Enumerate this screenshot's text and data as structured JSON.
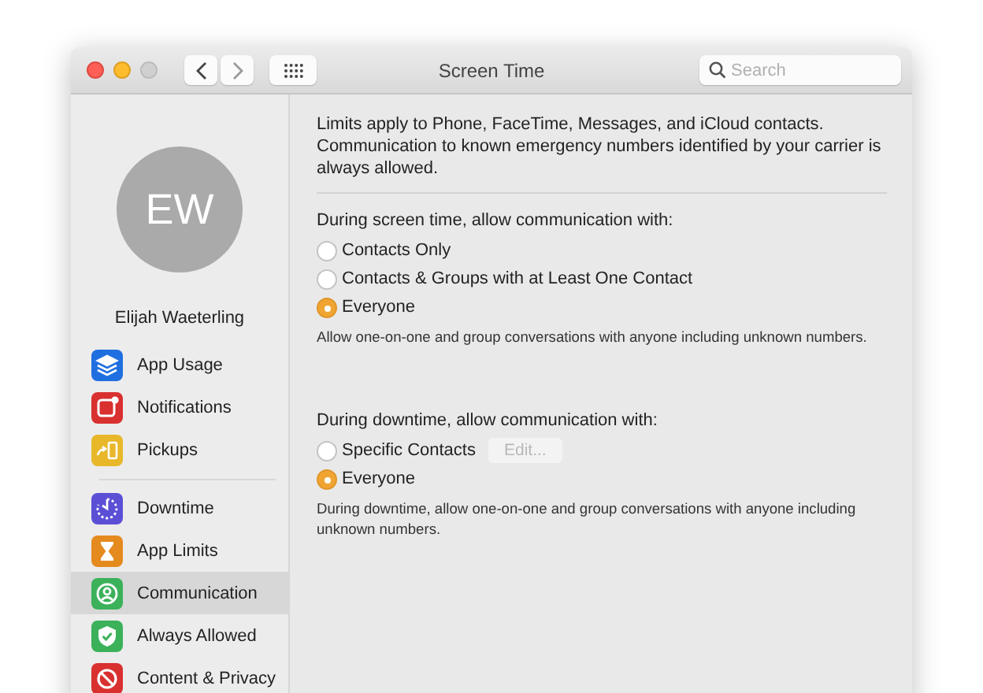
{
  "window": {
    "title": "Screen Time"
  },
  "search": {
    "placeholder": "Search"
  },
  "sidebar": {
    "avatar_initials": "EW",
    "user_name": "Elijah Waeterling",
    "groups": [
      [
        {
          "label": "App Usage",
          "color": "#1f6fe0",
          "selected": false
        },
        {
          "label": "Notifications",
          "color": "#d93030",
          "selected": false
        },
        {
          "label": "Pickups",
          "color": "#e8b82a",
          "selected": false
        }
      ],
      [
        {
          "label": "Downtime",
          "color": "#5b4fd6",
          "selected": false
        },
        {
          "label": "App Limits",
          "color": "#e58a1f",
          "selected": false
        },
        {
          "label": "Communication",
          "color": "#3bb15a",
          "selected": true
        },
        {
          "label": "Always Allowed",
          "color": "#3bb15a",
          "selected": false
        },
        {
          "label": "Content & Privacy",
          "color": "#d93030",
          "selected": false
        }
      ]
    ]
  },
  "intro": "Limits apply to Phone, FaceTime, Messages, and iCloud contacts. Communication to known emergency numbers identified by your carrier is always allowed.",
  "sections": [
    {
      "heading": "During screen time, allow communication with:",
      "options": [
        {
          "label": "Contacts Only",
          "selected": false
        },
        {
          "label": "Contacts & Groups with at Least One Contact",
          "selected": false
        },
        {
          "label": "Everyone",
          "selected": true
        }
      ],
      "note": "Allow one-on-one and group conversations with anyone including unknown numbers."
    },
    {
      "heading": "During downtime, allow communication with:",
      "options": [
        {
          "label": "Specific Contacts",
          "selected": false,
          "button": {
            "label": "Edit...",
            "disabled": true
          }
        },
        {
          "label": "Everyone",
          "selected": true
        }
      ],
      "note": "During downtime, allow one-on-one and group conversations with anyone including unknown numbers."
    }
  ]
}
